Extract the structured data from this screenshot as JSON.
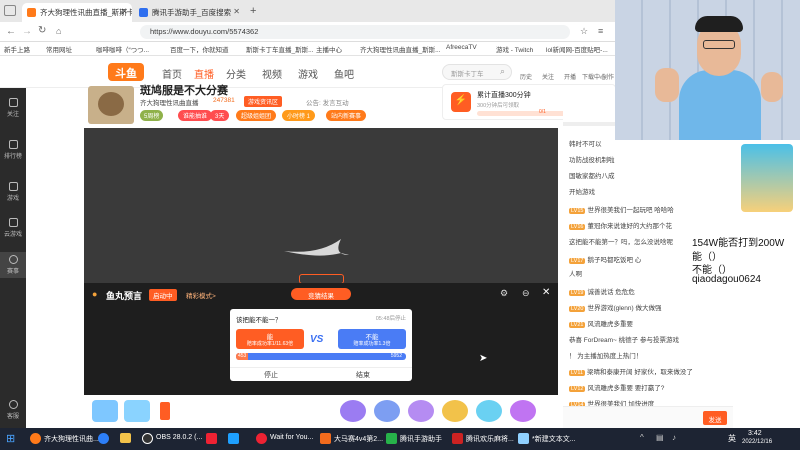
{
  "browser": {
    "tabs": [
      {
        "label": "齐大狗理性讯曲直播_斯斯卡丁车",
        "active": true
      },
      {
        "label": "腾讯手游助手_百度搜索",
        "active": false
      }
    ],
    "url": "https://www.douyu.com/5574362",
    "bookmarks": [
      "新手上路",
      "常用网址",
      "咖啡咖啡（“つつ...",
      "百度一下，你就知道",
      "斯斯卡丁车直播_斯斯...",
      "主播中心",
      "齐大狗理性讯曲直播_斯斯...",
      "AfreecaTV",
      "游戏 - Twitch",
      "lol新闻网-百度贴吧-..."
    ]
  },
  "site": {
    "logo": "斗鱼",
    "nav": [
      "首页",
      "直播",
      "分类",
      "视频",
      "游戏",
      "鱼吧"
    ],
    "search_placeholder": "斯斯卡丁车",
    "header_icons": [
      "历史",
      "关注",
      "开播",
      "下载中心",
      "创作"
    ]
  },
  "room": {
    "title": "斑鸠服是不大分赛",
    "streamer": "齐大狗理性讯曲直播",
    "heat": "247381",
    "tag1": "游戏资讯区",
    "notice": "公告: 发言互动",
    "level_badge": "5周榜",
    "chips": [
      "谁能抽谁",
      "3天",
      "超级姐姐团",
      "小时榜 1",
      "站内新赛事"
    ]
  },
  "live_notice": {
    "title": "累计直播300分钟",
    "subtitle": "300分钟后可领取",
    "progress_label": "0/1"
  },
  "rail": [
    "关注",
    "排行榜",
    "游戏",
    "云游戏",
    "赛事",
    "客服"
  ],
  "prediction": {
    "brand": "鱼丸预言",
    "status": "启动中",
    "mode": "精彩模式>",
    "center_button": "竞猜结果",
    "question": "该把能不能一？",
    "timer": "05:48后停止",
    "option_a": {
      "label": "能",
      "sub": "赔率成功率1/11.63倍",
      "amount": "453"
    },
    "option_b": {
      "label": "不能",
      "sub": "赔率成功率1.3倍",
      "amount": "5952"
    },
    "vs": "VS",
    "btn_stop": "停止",
    "btn_end": "结束"
  },
  "chat": {
    "lines": [
      {
        "lvl": "",
        "text": "韩时不可以"
      },
      {
        "lvl": "",
        "text": "功防战役机制啦"
      },
      {
        "lvl": "",
        "text": "国敏家都约八成"
      },
      {
        "lvl": "",
        "text": "开始游戏"
      },
      {
        "lvl": "LV15",
        "text": "世界很美我们一起玩吧  哈哈哈"
      },
      {
        "lvl": "LV16",
        "text": "董冠你来说谁好的大约那个花"
      },
      {
        "lvl": "",
        "text": "这把能不能第一？吗，怎么没说啥呢"
      },
      {
        "lvl": "LV17",
        "text": "鹅子吗都吃饭吧  心"
      },
      {
        "lvl": "",
        "text": "人啊"
      },
      {
        "lvl": "LV19",
        "text": "诚善说话  危危危"
      },
      {
        "lvl": "LV20",
        "text": "世界游戏(glenn)  做大做强"
      },
      {
        "lvl": "LV21",
        "text": "风流雕虎多重要"
      },
      {
        "lvl": "",
        "text": "恭喜 ForDream~ 桃德子 参与投票游戏"
      },
      {
        "lvl": "",
        "text": "！ 为主播加热度上热门！"
      },
      {
        "lvl": "LV11",
        "text": "梁晴和泰康开阔  好家伙，取来做没了"
      },
      {
        "lvl": "LV12",
        "text": "风流雕虎多重要  要打赢了?"
      },
      {
        "lvl": "LV14",
        "text": "世界很美我们  加快进度"
      }
    ],
    "send_label": "发送"
  },
  "overlay_text": [
    "154W能否打到200W",
    "能（）",
    "不能（）",
    "qiaodagou0624"
  ],
  "taskbar": {
    "items": [
      "齐大狗理性讯曲...",
      "OBS 28.0.2 (...",
      "Wait for You...",
      "大马赛4v4第2...",
      "腾讯手游助手",
      "腾讯欢乐麻将...",
      "*新建文本文..."
    ],
    "time": "3:42",
    "date": "2022/12/16",
    "lang": "英"
  },
  "colors": {
    "brand": "#ff5d23",
    "dark": "#1e1e1e",
    "taskbar": "#1d2433"
  }
}
